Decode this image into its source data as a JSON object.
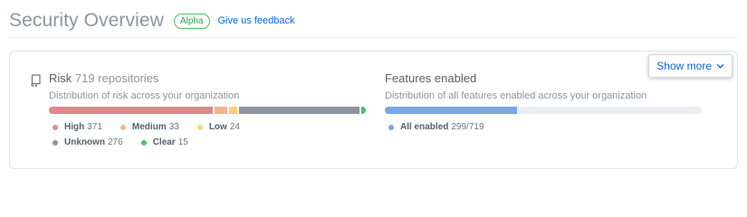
{
  "header": {
    "title": "Security Overview",
    "badge": "Alpha",
    "feedback_link": "Give us feedback"
  },
  "card": {
    "show_more_label": "Show more",
    "risk": {
      "icon": "repo-icon",
      "title_prefix": "Risk",
      "title_count": "719 repositories",
      "subtitle": "Distribution of risk across your organization",
      "total": 719,
      "segments": [
        {
          "label": "High",
          "value": 371,
          "color": "#e0868d"
        },
        {
          "label": "Medium",
          "value": 33,
          "color": "#f4b38c"
        },
        {
          "label": "Low",
          "value": 24,
          "color": "#f7d26f"
        },
        {
          "label": "Unknown",
          "value": 276,
          "color": "#8c959f"
        },
        {
          "label": "Clear",
          "value": 15,
          "color": "#4ac26b"
        }
      ]
    },
    "features": {
      "title": "Features enabled",
      "subtitle": "Distribution of all features enabled across your organization",
      "enabled": 299,
      "total": 719,
      "color": "#7aa5e8",
      "legend_label": "All enabled",
      "legend_value": "299/719"
    }
  }
}
